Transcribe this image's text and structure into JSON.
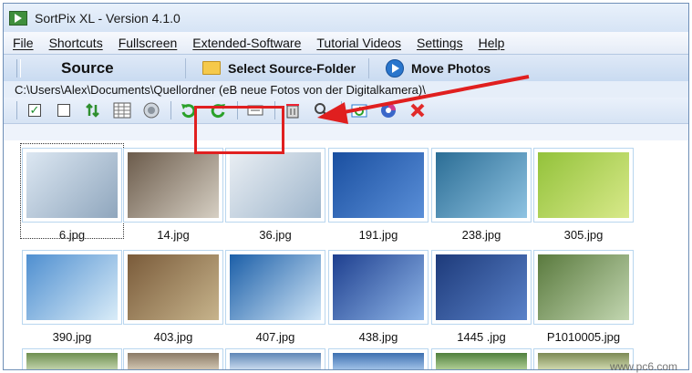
{
  "window": {
    "title": "SortPix XL - Version 4.1.0"
  },
  "menu": [
    "File",
    "Shortcuts",
    "Fullscreen",
    "Extended-Software",
    "Tutorial Videos",
    "Settings",
    "Help"
  ],
  "sourcebar": {
    "label": "Source",
    "select_folder": "Select Source-Folder",
    "move_photos": "Move Photos"
  },
  "path": "C:\\Users\\Alex\\Documents\\Quellordner (eB neue Fotos von der Digitalkamera)\\",
  "toolbar_icons": [
    "check-all-icon",
    "uncheck-all-icon",
    "sort-icon",
    "grid-view-icon",
    "speaker-icon",
    "rotate-left-icon",
    "rotate-right-icon",
    "resize-icon",
    "delete-image-icon",
    "zoom-icon",
    "refresh-icon",
    "color-icon",
    "close-red-icon"
  ],
  "thumbnails": [
    {
      "name": "6.jpg",
      "colors": [
        "#dce7f2",
        "#8fa6bd"
      ]
    },
    {
      "name": "14.jpg",
      "colors": [
        "#6b5b4b",
        "#d6cfc3"
      ]
    },
    {
      "name": "36.jpg",
      "colors": [
        "#e9eef3",
        "#9fb6cc"
      ]
    },
    {
      "name": "191.jpg",
      "colors": [
        "#1a4fa0",
        "#5a8fd8"
      ]
    },
    {
      "name": "238.jpg",
      "colors": [
        "#2b6d95",
        "#8fc3e2"
      ]
    },
    {
      "name": "305.jpg",
      "colors": [
        "#93c23a",
        "#d8e98a"
      ]
    },
    {
      "name": "390.jpg",
      "colors": [
        "#4f8fd0",
        "#d9ecf8"
      ]
    },
    {
      "name": "403.jpg",
      "colors": [
        "#7a5b3a",
        "#c7b48c"
      ]
    },
    {
      "name": "407.jpg",
      "colors": [
        "#1c5fa8",
        "#cfe5f7"
      ]
    },
    {
      "name": "438.jpg",
      "colors": [
        "#1e3f8f",
        "#8fb6e8"
      ]
    },
    {
      "name": "1445 .jpg",
      "colors": [
        "#1d3a7a",
        "#5a82c9"
      ]
    },
    {
      "name": "P1010005.jpg",
      "colors": [
        "#5a7a3e",
        "#c2d6b0"
      ]
    }
  ],
  "watermark": "www.pc6.com"
}
